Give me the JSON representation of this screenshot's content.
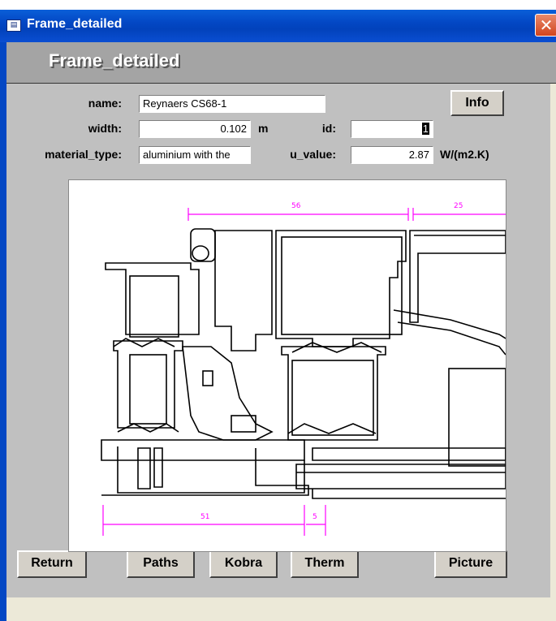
{
  "window": {
    "title": "Frame_detailed",
    "close_glyph": "✕",
    "app_icon": "form-icon"
  },
  "header": {
    "caption": "Frame_detailed"
  },
  "fields": {
    "name": {
      "label": "name:",
      "value": "Reynaers CS68-1"
    },
    "width": {
      "label": "width:",
      "value": "0.102",
      "unit": "m"
    },
    "id": {
      "label": "id:",
      "value": "1"
    },
    "material_type": {
      "label": "material_type:",
      "value": "aluminium with the"
    },
    "u_value": {
      "label": "u_value:",
      "value": "2.87",
      "unit": "W/(m2.K)"
    }
  },
  "buttons": {
    "info": "Info",
    "return": "Return",
    "paths": "Paths",
    "kobra": "Kobra",
    "therm": "Therm",
    "picture": "Picture"
  },
  "drawing": {
    "dimensions": [
      "56",
      "25",
      "51",
      "5"
    ],
    "dimension_color": "#ff00ff"
  }
}
